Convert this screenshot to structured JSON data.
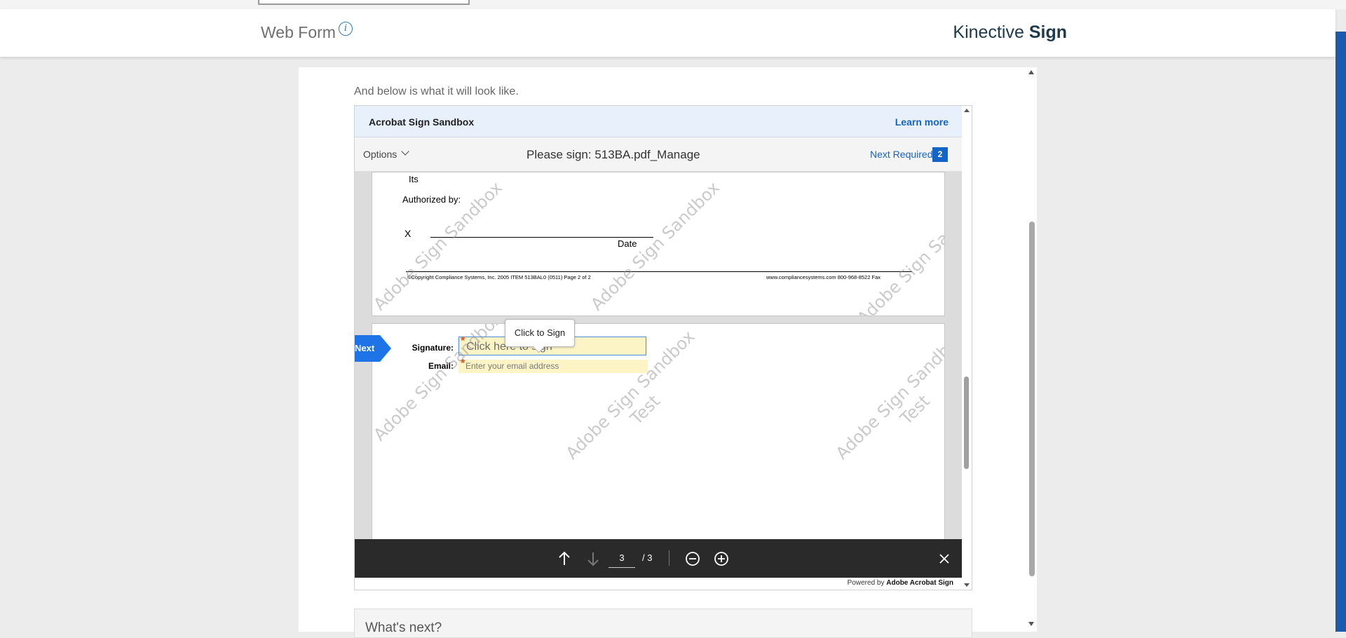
{
  "header": {
    "title": "Web Form",
    "info_icon": "i",
    "brand_regular": "Kinective",
    "brand_bold": "Sign"
  },
  "content": {
    "intro": "And below is what it will look like."
  },
  "frame": {
    "sandbox_name": "Acrobat Sign Sandbox",
    "learn_more": "Learn more",
    "options_label": "Options",
    "doc_title": "Please sign: 513BA.pdf_Manage",
    "next_required_label": "Next Required",
    "next_required_count": "2"
  },
  "page1": {
    "its": "Its",
    "authorized_by": "Authorized by:",
    "x_mark": "X",
    "date_label": "Date",
    "copyright": "©Copyright Compliance Systems, Inc.  2005  ITEM 513BAL0  (0511)  Page 2 of 2",
    "website": "www.compliancesystems.com   800-968-8522 Fax"
  },
  "page2": {
    "tooltip": "Click to Sign",
    "next_arrow": "Next",
    "signature_label": "Signature:",
    "signature_placeholder": "Click here to sign",
    "email_label": "Email:",
    "email_placeholder": "Enter your email address",
    "required_mark": "*"
  },
  "watermark": {
    "line1": "Adobe Sign Sandbox",
    "line2": "Test"
  },
  "bottom_bar": {
    "current_page": "3",
    "total_pages": "/ 3",
    "icons": [
      "arrow-up-icon",
      "arrow-down-icon",
      "zoom-out-icon",
      "zoom-in-icon",
      "close-icon"
    ]
  },
  "powered_by": {
    "prefix": "Powered by",
    "brand": "Adobe Acrobat Sign"
  },
  "next_section": {
    "title": "What's next?"
  },
  "colors": {
    "accent": "#1464c8",
    "brand_text": "#1e3b4d",
    "field_bg": "#fdf4c6",
    "required": "#e04a1a",
    "toolbar_dark": "#2a2a2a"
  }
}
